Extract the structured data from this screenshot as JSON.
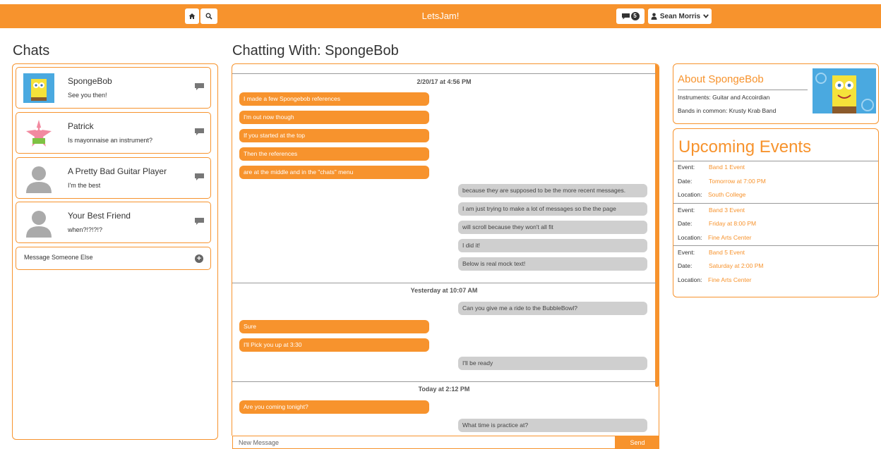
{
  "nav": {
    "brand": "LetsJam!",
    "message_count": "5",
    "user_name": "Sean Morris"
  },
  "headings": {
    "chats": "Chats",
    "chatting_with": "Chatting With: SpongeBob"
  },
  "chats": [
    {
      "name": "SpongeBob",
      "preview": "See you then!",
      "avatar": "spongebob-avatar"
    },
    {
      "name": "Patrick",
      "preview": "Is mayonnaise an instrument?",
      "avatar": "patrick-avatar"
    },
    {
      "name": "A Pretty Bad Guitar Player",
      "preview": "I'm the best",
      "avatar": "default-avatar"
    },
    {
      "name": "Your Best Friend",
      "preview": "when?!?!?!?",
      "avatar": "default-avatar"
    }
  ],
  "new_message_label": "Message Someone Else",
  "conversation": [
    {
      "date": "2/20/17 at 4:56 PM",
      "messages": [
        {
          "from": "me",
          "text": "I made a few Spongebob references"
        },
        {
          "from": "me",
          "text": "I'm out now though"
        },
        {
          "from": "me",
          "text": "If you started at the top"
        },
        {
          "from": "me",
          "text": "Then the references"
        },
        {
          "from": "me",
          "text": "are at the middle and in the \"chats\" menu"
        },
        {
          "from": "them",
          "text": "because they are supposed to be the more recent messages."
        },
        {
          "from": "them",
          "text": "I am just trying to make a lot of messages so the the page"
        },
        {
          "from": "them",
          "text": "will scroll because they won't all fit"
        },
        {
          "from": "them",
          "text": "I did it!"
        },
        {
          "from": "them",
          "text": "Below is real mock text!"
        }
      ]
    },
    {
      "date": "Yesterday at 10:07 AM",
      "messages": [
        {
          "from": "them",
          "text": "Can you give me a ride to the BubbleBowl?"
        },
        {
          "from": "me",
          "text": "Sure"
        },
        {
          "from": "me",
          "text": "I'll Pick you up at 3:30"
        },
        {
          "from": "them",
          "text": "I'll be ready"
        }
      ]
    },
    {
      "date": "Today at 2:12 PM",
      "messages": [
        {
          "from": "me",
          "text": "Are you coming tonight?"
        },
        {
          "from": "them",
          "text": "What time is practice at?"
        }
      ]
    }
  ],
  "composer": {
    "placeholder": "New Message",
    "send_label": "Send"
  },
  "about": {
    "title": "About SpongeBob",
    "instruments": "Instruments: Guitar and Accoirdian",
    "bands": "Bands in common: Krusty Krab Band"
  },
  "events": {
    "title": "Upcoming Events",
    "event_key": "Event:",
    "date_key": "Date:",
    "location_key": "Location:",
    "items": [
      {
        "event": "Band 1 Event",
        "date": "Tomorrow at 7:00 PM",
        "location": "South College"
      },
      {
        "event": "Band 3 Event",
        "date": "Friday at 8:00 PM",
        "location": "Fine Arts Center"
      },
      {
        "event": "Band 5 Event",
        "date": "Saturday at 2:00 PM",
        "location": "Fine Arts Center"
      }
    ]
  },
  "colors": {
    "accent": "#f7932d",
    "incoming_bubble": "#cfcfcf"
  }
}
